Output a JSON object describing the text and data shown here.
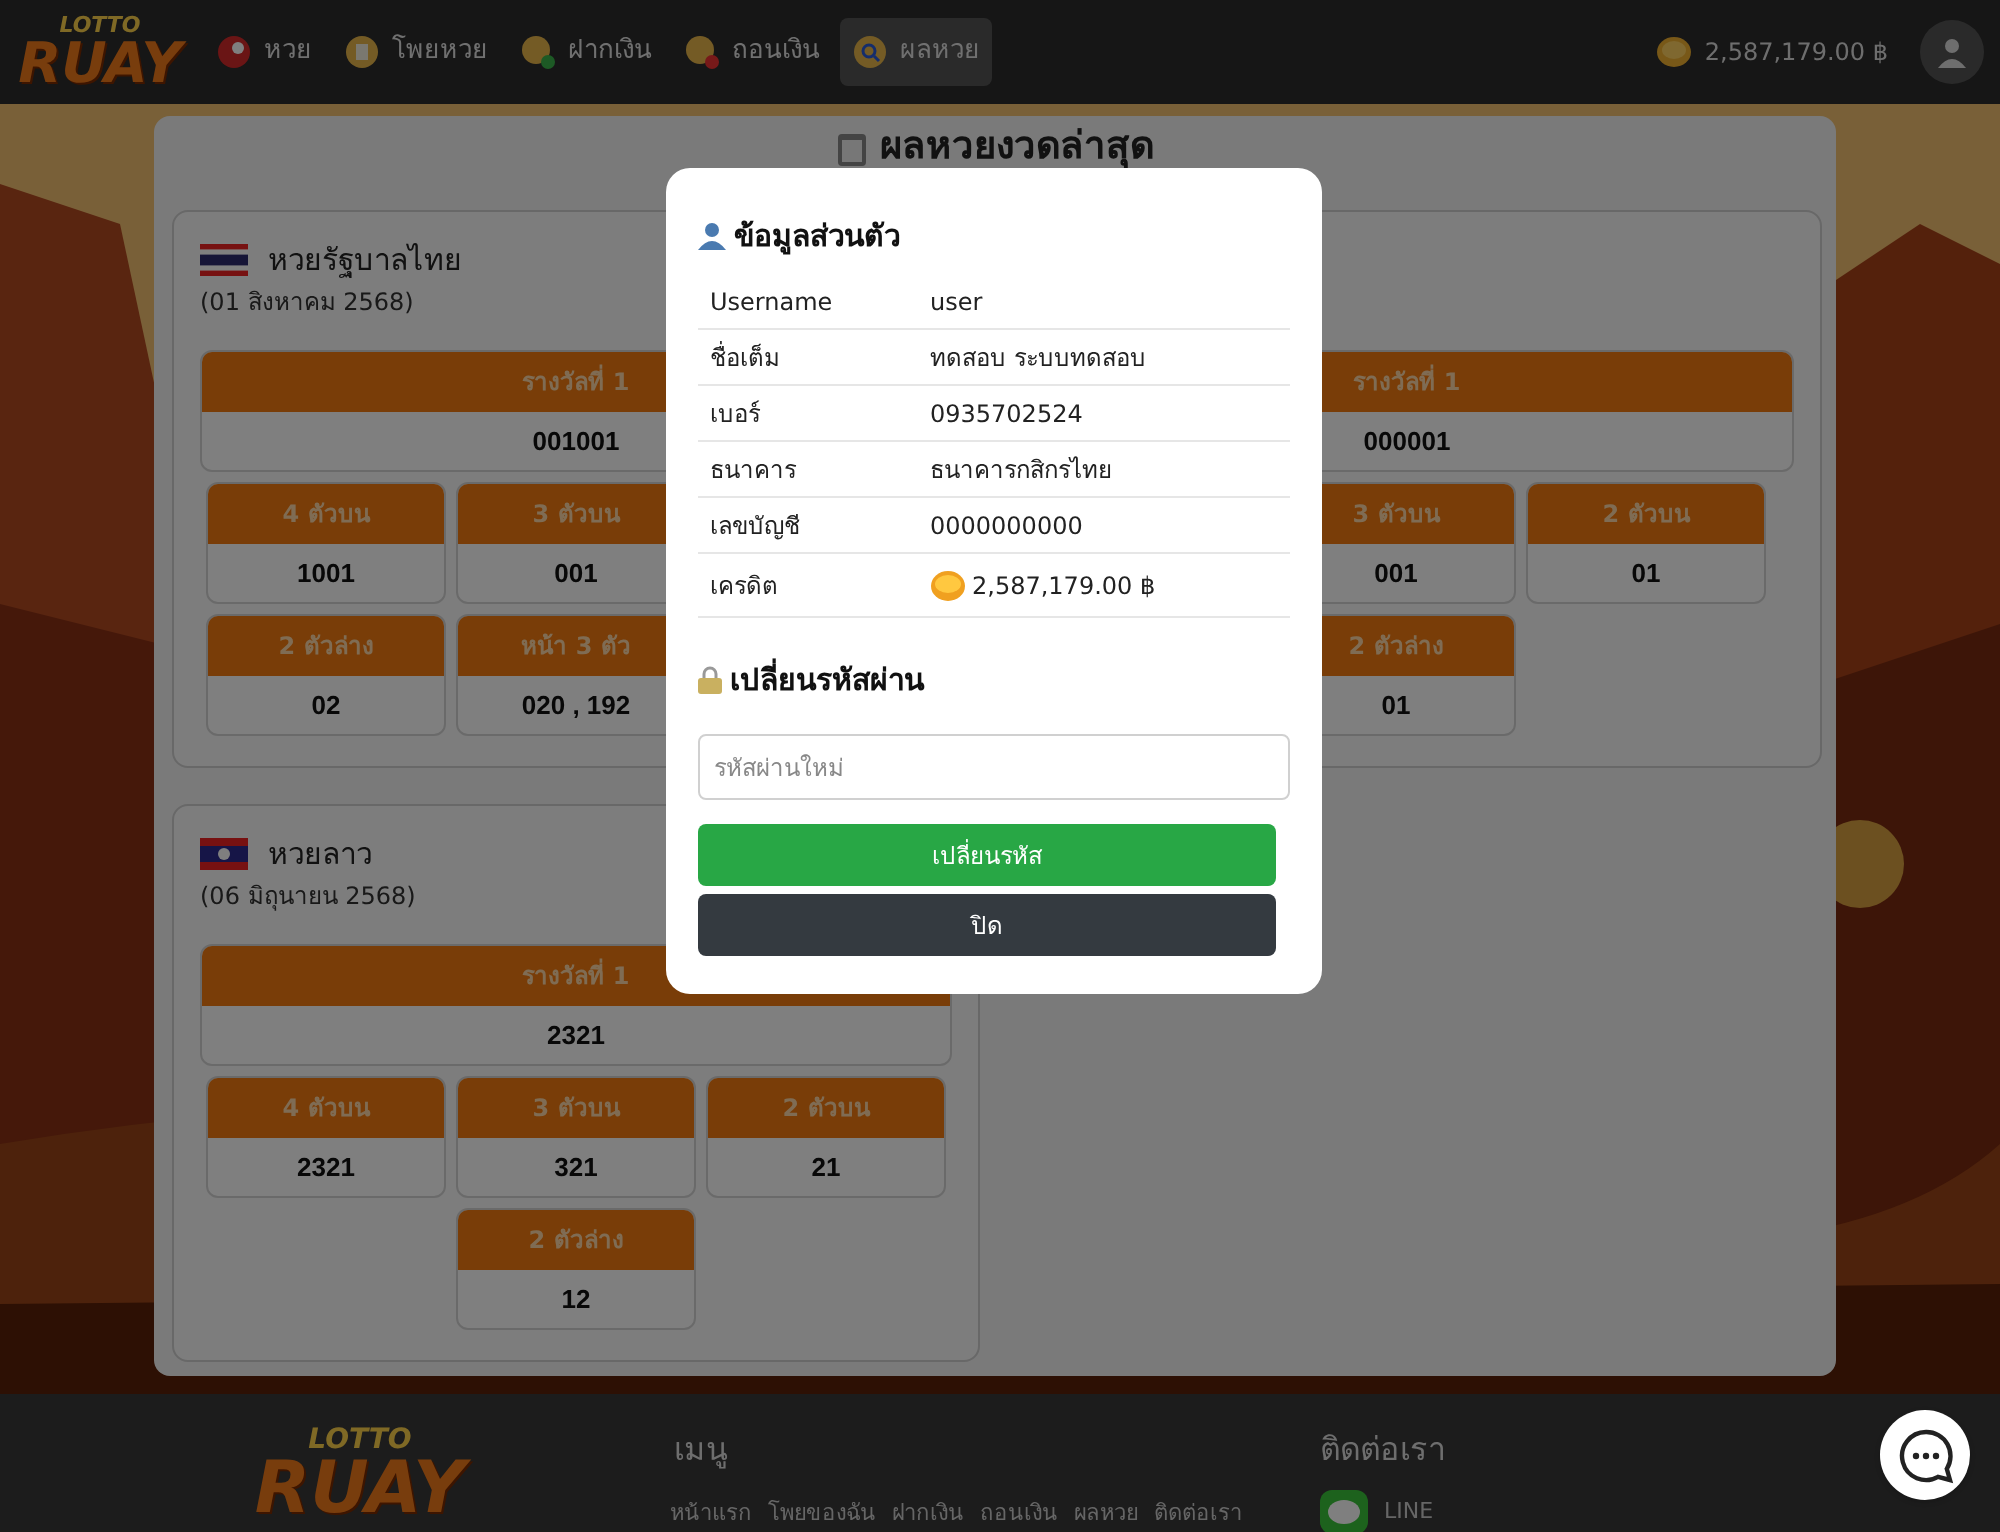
{
  "header": {
    "logo_top": "LOTTO",
    "logo_bottom": "RUAY",
    "nav": [
      {
        "label": "หวย",
        "selected": false
      },
      {
        "label": "โพยหวย",
        "selected": false
      },
      {
        "label": "ฝากเงิน",
        "selected": false
      },
      {
        "label": "ถอนเงิน",
        "selected": false
      },
      {
        "label": "ผลหวย",
        "selected": true
      }
    ],
    "balance": "2,587,179.00 ฿"
  },
  "page_title": "ผลหวยงวดล่าสุด",
  "cards": [
    {
      "title": "หวยรัฐบาลไทย",
      "date": "(01 สิงหาคม 2568)",
      "first_prize": {
        "label": "รางวัลที่ 1",
        "value": "001001"
      },
      "rows": [
        [
          {
            "label": "4 ตัวบน",
            "value": "1001"
          },
          {
            "label": "3 ตัวบน",
            "value": "001"
          }
        ],
        [
          {
            "label": "2 ตัวล่าง",
            "value": "02"
          },
          {
            "label": "หน้า 3 ตัว",
            "value": "020 , 192"
          }
        ]
      ]
    },
    {
      "first_prize": {
        "label": "รางวัลที่ 1",
        "value": "000001"
      },
      "rows": [
        [
          "",
          {
            "label": "3 ตัวบน",
            "value": "001"
          },
          {
            "label": "2 ตัวบน",
            "value": "01"
          }
        ],
        [
          "",
          {
            "label": "2 ตัวล่าง",
            "value": "01"
          }
        ]
      ]
    },
    {
      "title": "หวยลาว",
      "date": "(06 มิถุนายน 2568)",
      "first_prize": {
        "label": "รางวัลที่ 1",
        "value": "2321"
      },
      "rows": [
        [
          {
            "label": "4 ตัวบน",
            "value": "2321"
          },
          {
            "label": "3 ตัวบน",
            "value": "321"
          },
          {
            "label": "2 ตัวบน",
            "value": "21"
          }
        ],
        [
          "",
          {
            "label": "2 ตัวล่าง",
            "value": "12"
          }
        ]
      ]
    }
  ],
  "modal": {
    "title": "ข้อมูลส่วนตัว",
    "rows": [
      {
        "label": "Username",
        "value": "user"
      },
      {
        "label": "ชื่อเต็ม",
        "value": "ทดสอบ ระบบทดสอบ"
      },
      {
        "label": "เบอร์",
        "value": "0935702524"
      },
      {
        "label": "ธนาคาร",
        "value": "ธนาคารกสิกรไทย"
      },
      {
        "label": "เลขบัญชี",
        "value": "0000000000"
      },
      {
        "label": "เครดิต",
        "value": "2,587,179.00 ฿",
        "kind": "credit"
      }
    ],
    "password_title": "เปลี่ยนรหัสผ่าน",
    "password_placeholder": "รหัสผ่านใหม่",
    "submit": "เปลี่ยนรหัส",
    "close": "ปิด"
  },
  "footer": {
    "logo_top": "LOTTO",
    "logo_bottom": "RUAY",
    "menu_title": "เมนู",
    "links": [
      "หน้าแรก",
      "โพยของฉัน",
      "ฝากเงิน",
      "ถอนเงิน",
      "ผลหวย",
      "ติดต่อเรา"
    ],
    "contact_title": "ติดต่อเรา",
    "line": "LINE"
  }
}
